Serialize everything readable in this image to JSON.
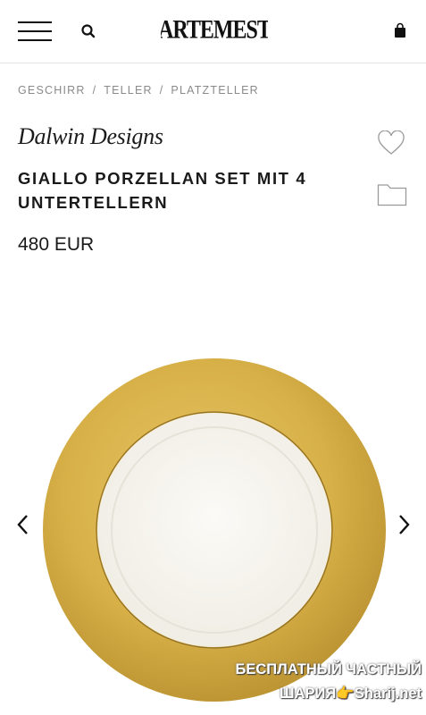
{
  "header": {
    "logo_text": "ARTEMEST",
    "icons": {
      "menu": "hamburger-menu-icon",
      "search": "search-icon",
      "cart": "shopping-bag-icon"
    }
  },
  "breadcrumb": {
    "items": [
      "GESCHIRR",
      "TELLER",
      "PLATZTELLER"
    ],
    "separator": "/"
  },
  "product": {
    "brand": "Dalwin Designs",
    "title": "GIALLO PORZELLAN SET MIT 4 UNTERTELLERN",
    "price": "480 EUR",
    "image": {
      "subject": "gold-rimmed white porcelain plate",
      "rim_color": "#cfa84a",
      "center_color": "#f4f2ec"
    }
  },
  "actions": {
    "wishlist_icon": "heart-icon",
    "folder_icon": "folder-icon"
  },
  "carousel": {
    "prev_icon": "chevron-left-icon",
    "next_icon": "chevron-right-icon"
  },
  "watermark": {
    "line1": "БЕСПЛАТНЫЙ ЧАСТНЫЙ",
    "line2": "ШАРИЯ👉Sharij.net"
  }
}
